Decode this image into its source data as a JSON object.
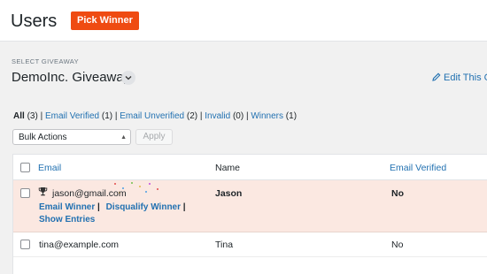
{
  "header": {
    "title": "Users",
    "pick_winner_label": "Pick Winner"
  },
  "giveaway": {
    "select_label": "SELECT GIVEAWAY",
    "name": "DemoInc. Giveaway",
    "edit_label": "Edit This G"
  },
  "filters": [
    {
      "label": "All",
      "count": "(3)"
    },
    {
      "label": "Email Verified",
      "count": "(1)"
    },
    {
      "label": "Email Unverified",
      "count": "(2)"
    },
    {
      "label": "Invalid",
      "count": "(0)"
    },
    {
      "label": "Winners",
      "count": "(1)"
    }
  ],
  "bulk": {
    "selected": "Bulk Actions",
    "apply_label": "Apply"
  },
  "table": {
    "columns": [
      "Email",
      "Name",
      "Email Verified"
    ],
    "rows": [
      {
        "email": "jason@gmail.com",
        "name": "Jason",
        "verified": "No",
        "winner": true,
        "actions": [
          "Email Winner",
          "Disqualify Winner",
          "Show Entries"
        ],
        "separator": "|"
      },
      {
        "email": "tina@example.com",
        "name": "Tina",
        "verified": "No",
        "winner": false
      }
    ]
  },
  "colors": {
    "accent": "#ef4b12",
    "link": "#2271b1",
    "winner_row_bg": "#fbe8e1"
  },
  "icons": [
    "chevron-down-icon",
    "pencil-icon",
    "trophy-icon",
    "confetti-decoration"
  ]
}
